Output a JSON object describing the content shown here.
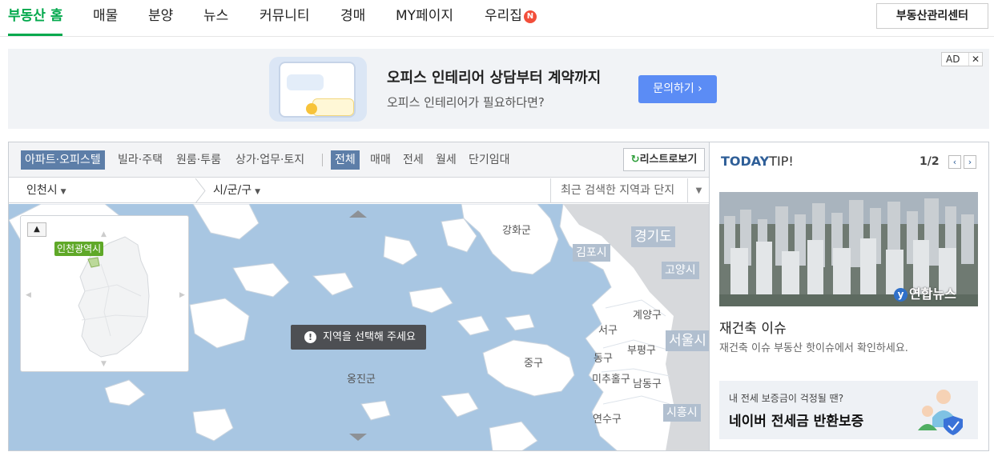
{
  "nav": {
    "items": [
      {
        "label": "부동산 홈",
        "active": true
      },
      {
        "label": "매물"
      },
      {
        "label": "분양"
      },
      {
        "label": "뉴스"
      },
      {
        "label": "커뮤니티"
      },
      {
        "label": "경매"
      },
      {
        "label": "MY페이지"
      },
      {
        "label": "우리집"
      }
    ],
    "new_badge": "N",
    "management_button": "부동산관리센터"
  },
  "ad": {
    "title": "오피스 인테리어 상담부터 계약까지",
    "subtitle": "오피스 인테리어가 필요하다면?",
    "cta": "문의하기 ›",
    "tag_label": "AD",
    "close": "✕"
  },
  "map_panel": {
    "property_types": [
      "아파트·오피스텔",
      "빌라·주택",
      "원룸·투룸",
      "상가·업무·토지"
    ],
    "deal_types": [
      "전체",
      "매매",
      "전세",
      "월세",
      "단기임대"
    ],
    "list_button": "리스트로보기",
    "region": {
      "sido": "인천시",
      "sigungu": "시/군/구"
    },
    "recent_search_placeholder": "최근 검색한 지역과 단지",
    "notice": "지역을 선택해 주세요",
    "minimap_label": "인천광역시",
    "map_labels": {
      "ganghwa": "강화군",
      "gyeonggi": "경기도",
      "gimpo": "김포시",
      "goyang": "고양시",
      "gyeyang": "계양구",
      "seo": "서구",
      "bupyeong": "부평구",
      "seoul": "서울시",
      "jung": "중구",
      "dong": "동구",
      "michuhol": "미추홀구",
      "namdong": "남동구",
      "ongjin": "옹진군",
      "yeonsu": "연수구",
      "siheung": "시흥시"
    }
  },
  "tip": {
    "title_a": "TODAY",
    "title_b": "TIP!",
    "pager": "1/2",
    "prev": "‹",
    "next": "›",
    "photo_credit": "연합뉴스",
    "headline": "재건축 이슈",
    "description": "재건축 이슈 부동산 핫이슈에서 확인하세요.",
    "banner_line1": "내 전세 보증금이 걱정될 땐?",
    "banner_line2": "네이버 전세금 반환보증"
  },
  "colors": {
    "brand_green": "#03a94d",
    "sea": "#a8c6e2",
    "land": "#ffffff",
    "selected_tab": "#5d7ea8",
    "ad_cta": "#5b8cf5"
  }
}
